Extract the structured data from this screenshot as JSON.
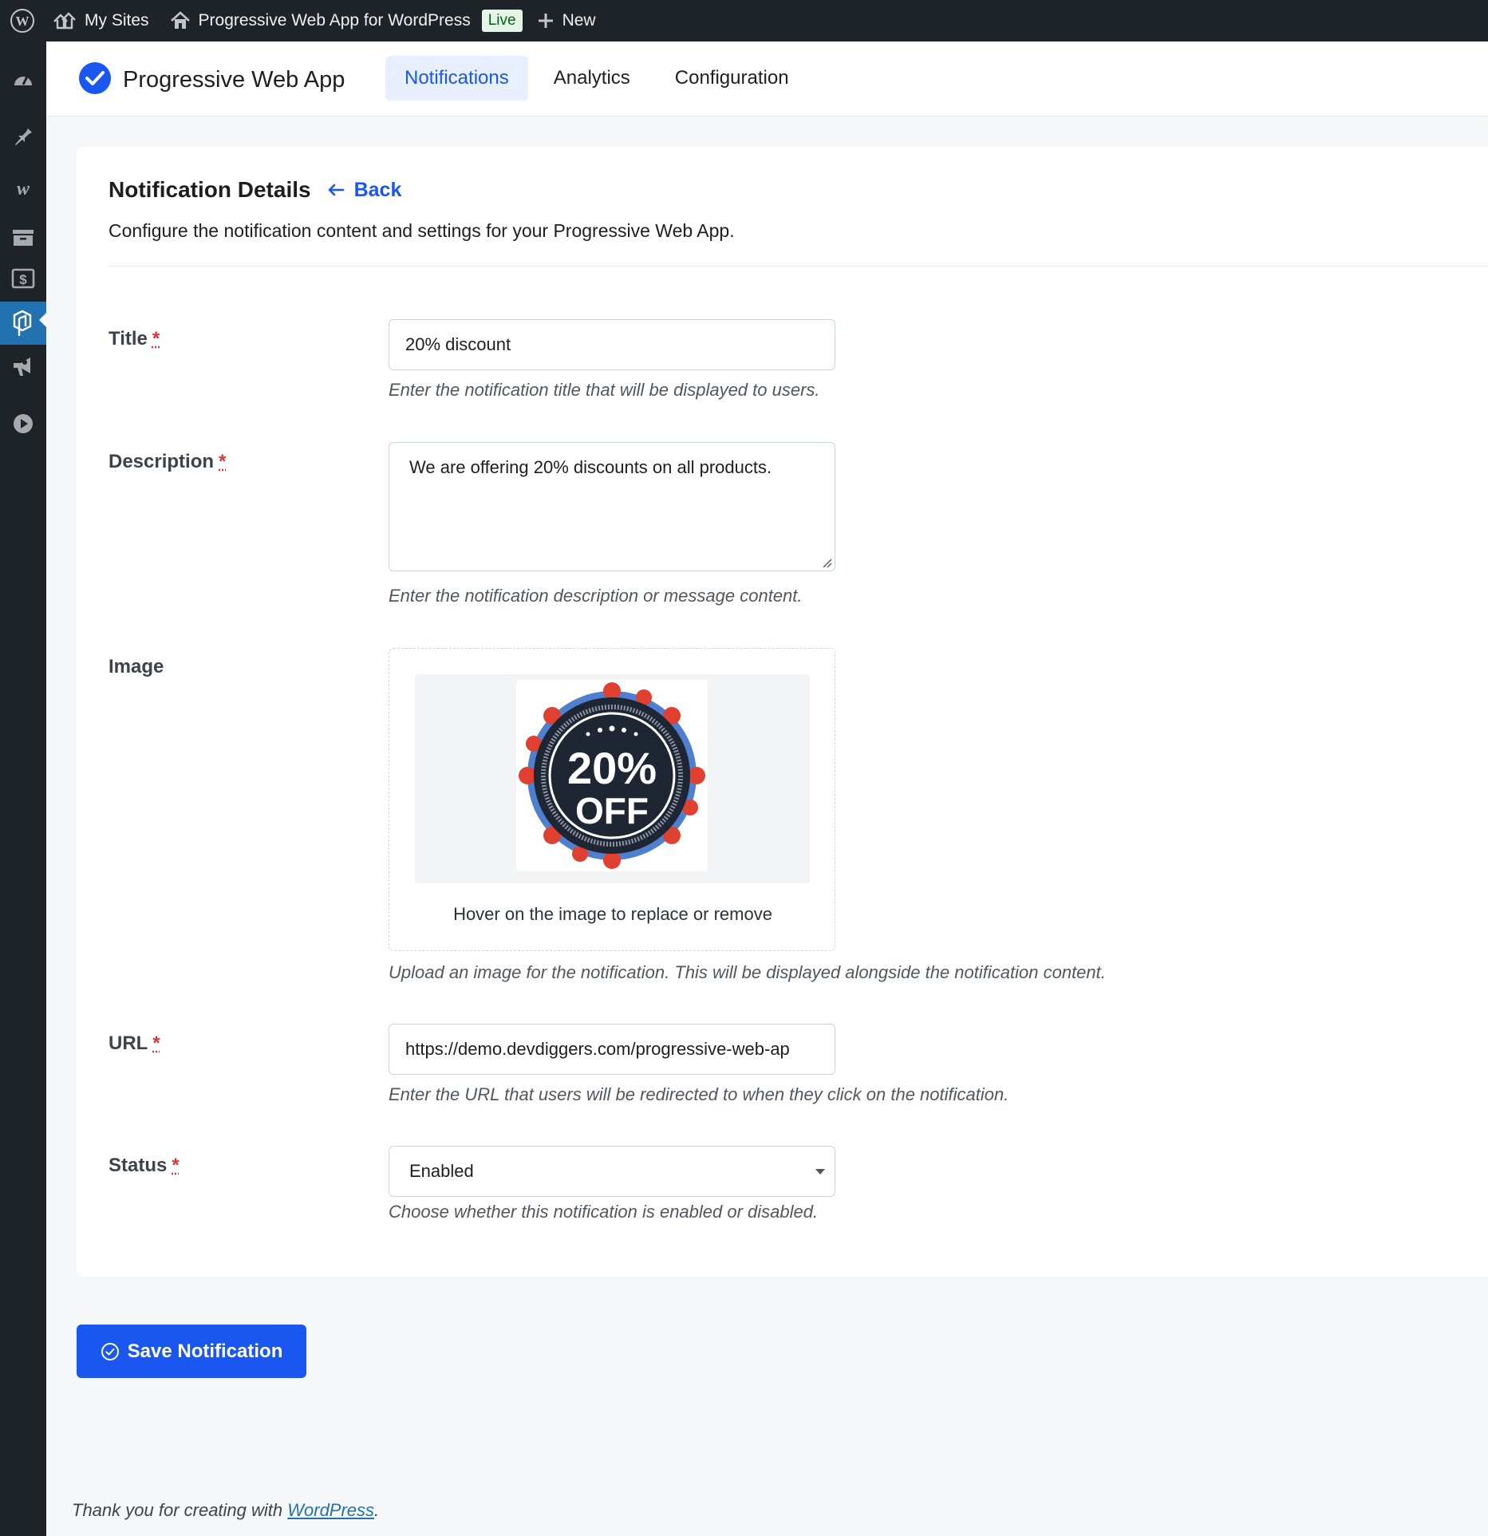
{
  "adminbar": {
    "my_sites": "My Sites",
    "site_name": "Progressive Web App for WordPress",
    "live_badge": "Live",
    "new_label": "New"
  },
  "sidebar": {
    "icons": [
      "dashboard-icon",
      "pin-icon",
      "woo-icon",
      "archive-icon",
      "dollar-icon",
      "pwa-plugin-icon",
      "megaphone-icon",
      "play-icon"
    ],
    "active": "pwa-plugin-icon"
  },
  "header": {
    "brand": "Progressive Web App",
    "tabs": [
      "Notifications",
      "Analytics",
      "Configuration"
    ],
    "active_tab": "Notifications"
  },
  "card": {
    "title": "Notification Details",
    "back_label": "Back",
    "description": "Configure the notification content and settings for your Progressive Web App."
  },
  "form": {
    "required_mark": "*",
    "title": {
      "label": "Title",
      "value": "20% discount",
      "hint": "Enter the notification title that will be displayed to users."
    },
    "description": {
      "label": "Description",
      "value": "We are offering 20% discounts on all products.",
      "hint": "Enter the notification description or message content."
    },
    "image": {
      "label": "Image",
      "badge_line1": "20%",
      "badge_line2": "OFF",
      "caption": "Hover on the image to replace or remove",
      "hint": "Upload an image for the notification. This will be displayed alongside the notification content."
    },
    "url": {
      "label": "URL",
      "value": "https://demo.devdiggers.com/progressive-web-ap",
      "hint": "Enter the URL that users will be redirected to when they click on the notification."
    },
    "status": {
      "label": "Status",
      "value": "Enabled",
      "hint": "Choose whether this notification is enabled or disabled."
    }
  },
  "save_button": "Save Notification",
  "footer": {
    "text": "Thank you for creating with ",
    "link": "WordPress",
    "suffix": "."
  },
  "colors": {
    "accent": "#1a56f0",
    "admin_bar": "#1d2327",
    "required": "#d63638",
    "live_badge_bg": "#e4f5e7"
  }
}
